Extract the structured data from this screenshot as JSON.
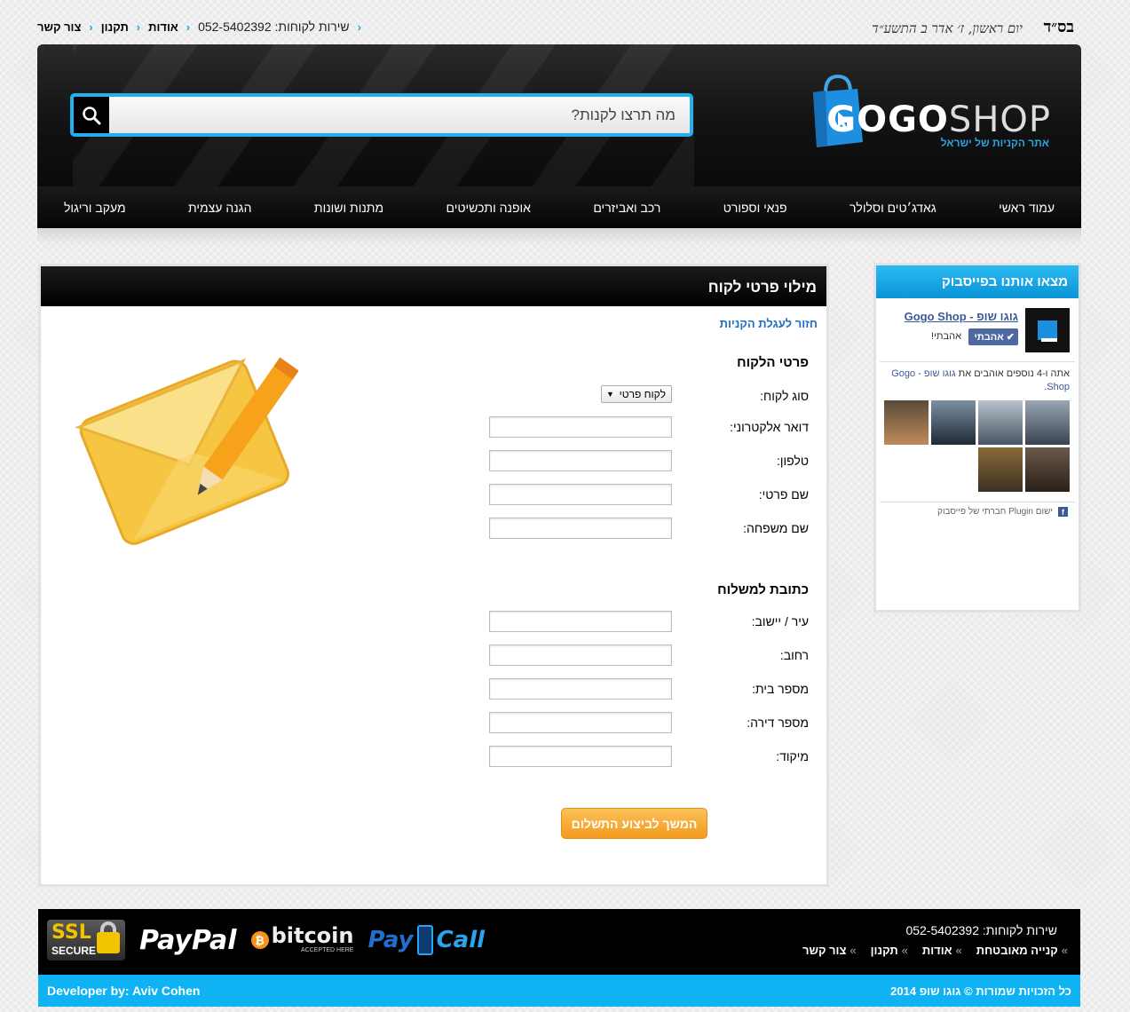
{
  "topbar": {
    "bsd": "בס״ד",
    "hebrew_date": "יום ראשון, ז׳ אדר ב התשע״ד",
    "links": [
      {
        "label": "צור קשר"
      },
      {
        "label": "תקנון"
      },
      {
        "label": "אודות"
      }
    ],
    "service_phone": "שירות לקוחות: 052-5402392"
  },
  "header": {
    "logo_text_a": "GOGO",
    "logo_text_b": "SHOP",
    "tagline": "אתר הקניות של ישראל",
    "search_placeholder": "מה תרצו לקנות?"
  },
  "nav": [
    {
      "label": "עמוד ראשי"
    },
    {
      "label": "גאדג׳טים וסלולר"
    },
    {
      "label": "פנאי וספורט"
    },
    {
      "label": "רכב ואביזרים"
    },
    {
      "label": "אופנה ותכשיטים"
    },
    {
      "label": "מתנות ושונות"
    },
    {
      "label": "הגנה עצמית"
    },
    {
      "label": "מעקב וריגול"
    }
  ],
  "main": {
    "title": "מילוי פרטי לקוח",
    "back_link": "חזור לעגלת הקניות",
    "customer_section": "פרטי הלקוח",
    "customer_type_label": "סוג לקוח:",
    "customer_type_value": "לקוח פרטי",
    "email_label": "דואר אלקטרוני:",
    "phone_label": "טלפון:",
    "first_name_label": "שם פרטי:",
    "last_name_label": "שם משפחה:",
    "shipping_section": "כתובת למשלוח",
    "city_label": "עיר / יישוב:",
    "street_label": "רחוב:",
    "house_label": "מספר בית:",
    "apt_label": "מספר דירה:",
    "zip_label": "מיקוד:",
    "continue_button": "המשך לביצוע התשלום"
  },
  "facebook": {
    "title": "מצאו אותנו בפייסבוק",
    "page_name": "גוגו שופ - Gogo Shop",
    "like_button": "אהבתי",
    "liked_text": "אהבתי!",
    "count_prefix": "אתה ו-4 נוספים אוהבים את",
    "count_link": "גוגו שופ - Gogo Shop",
    "count_suffix": ".",
    "plugin_text": "ישום Plugin חברתי של פייסבוק"
  },
  "footer": {
    "service": "שירות לקוחות: 052-5402392",
    "links": [
      {
        "label": "קנייה מאובטחת"
      },
      {
        "label": "אודות"
      },
      {
        "label": "תקנון"
      },
      {
        "label": "צור קשר"
      }
    ],
    "ssl_1": "SSL",
    "ssl_2": "SECURE",
    "paypal_a": "Pay",
    "paypal_b": "Pal",
    "bitcoin": "bitcoin",
    "bitcoin_sub": "ACCEPTED HERE",
    "paycall_a": "Pay",
    "paycall_b": "Call",
    "copyright": "כל הזכויות שמורות © גוגו שופ 2014",
    "developer": "Developer by: Aviv Cohen"
  },
  "colors": {
    "accent_blue": "#0fb2f2",
    "button_orange": "#f39a1f",
    "header_black": "#111111"
  }
}
